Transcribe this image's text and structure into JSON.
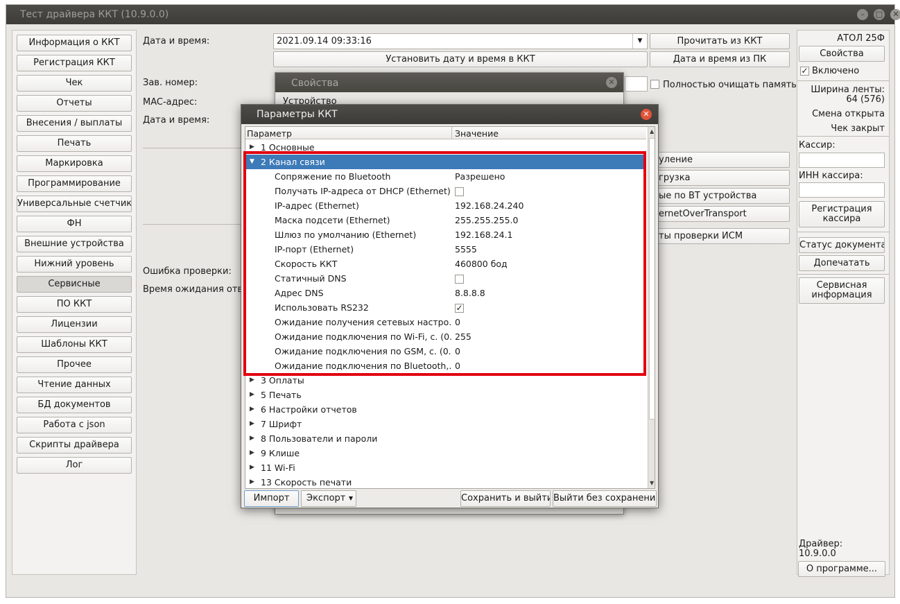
{
  "window": {
    "title": "Тест драйвера ККТ (10.9.0.0)"
  },
  "nav": [
    "Информация о ККТ",
    "Регистрация ККТ",
    "Чек",
    "Отчеты",
    "Внесения / выплаты",
    "Печать",
    "Маркировка",
    "Программирование",
    "Универсальные счетчики",
    "ФН",
    "Внешние устройства",
    "Нижний уровень",
    "Сервисные",
    "ПО ККТ",
    "Лицензии",
    "Шаблоны ККТ",
    "Прочее",
    "Чтение данных",
    "БД документов",
    "Работа с json",
    "Скрипты драйвера",
    "Лог"
  ],
  "nav_selected": "Сервисные",
  "main": {
    "date_label": "Дата и время:",
    "date_value": "2021.09.14 09:33:16",
    "read_btn": "Прочитать из ККТ",
    "set_btn": "Установить дату и время в ККТ",
    "pc_btn": "Дата и время из ПК",
    "serial_label": "Зав. номер:",
    "mac_label": "MAC-адрес:",
    "date_label2": "Дата и время:",
    "clear_label": "Полностью очищать память",
    "btn_a": "уление",
    "btn_b": "грузка",
    "btn_c": "ые по BT устройства",
    "btn_d": "ernetOverTransport",
    "btn_e": "ты проверки ИСМ",
    "err_label": "Ошибка проверки:",
    "wait_label": "Время ожидания ответ"
  },
  "right": {
    "model": "АТОЛ 25Ф",
    "props_btn": "Свойства",
    "enabled_label": "Включено",
    "tape_label": "Ширина ленты:",
    "tape_value": "64 (576)",
    "shift": "Смена открыта",
    "receipt": "Чек закрыт",
    "cashier_label": "Кассир:",
    "inn_label": "ИНН кассира:",
    "reg_btn_1": "Регистрация",
    "reg_btn_2": "кассира",
    "status_btn": "Статус документа",
    "reprint_btn": "Допечатать",
    "service_btn_1": "Сервисная",
    "service_btn_2": "информация",
    "driver_label": "Драйвер:",
    "driver_version": "10.9.0.0",
    "about_btn": "О программе..."
  },
  "props_dialog": {
    "title": "Свойства",
    "tab": "Устройство"
  },
  "params_dialog": {
    "title": "Параметры ККТ",
    "col_param": "Параметр",
    "col_value": "Значение",
    "rows": [
      {
        "label": "1 Основные",
        "group": true,
        "expanded": false
      },
      {
        "label": "2 Канал связи",
        "group": true,
        "expanded": true,
        "selected": true
      },
      {
        "label": "Сопряжение по Bluetooth",
        "value": "Разрешено"
      },
      {
        "label": "Получать IP-адреса от DHCP (Ethernet)",
        "check": false
      },
      {
        "label": "IP-адрес (Ethernet)",
        "value": "192.168.24.240"
      },
      {
        "label": "Маска подсети (Ethernet)",
        "value": "255.255.255.0"
      },
      {
        "label": "Шлюз по умолчанию (Ethernet)",
        "value": "192.168.24.1"
      },
      {
        "label": "IP-порт (Ethernet)",
        "value": "5555"
      },
      {
        "label": "Скорость ККТ",
        "value": "460800 бод"
      },
      {
        "label": "Статичный DNS",
        "check": false
      },
      {
        "label": "Адрес DNS",
        "value": "8.8.8.8"
      },
      {
        "label": "Использовать RS232",
        "check": true
      },
      {
        "label": "Ожидание получения сетевых настро...",
        "value": "0"
      },
      {
        "label": "Ожидание подключения по Wi-Fi, с. (0...",
        "value": "255"
      },
      {
        "label": "Ожидание подключения по GSM, с. (0...",
        "value": "0"
      },
      {
        "label": "Ожидание подключения по Bluetooth,...",
        "value": "0"
      },
      {
        "label": "3 Оплаты",
        "group": true,
        "expanded": false
      },
      {
        "label": "5 Печать",
        "group": true,
        "expanded": false
      },
      {
        "label": "6 Настройки отчетов",
        "group": true,
        "expanded": false
      },
      {
        "label": "7 Шрифт",
        "group": true,
        "expanded": false
      },
      {
        "label": "8 Пользователи и пароли",
        "group": true,
        "expanded": false
      },
      {
        "label": "9 Клише",
        "group": true,
        "expanded": false
      },
      {
        "label": "11 Wi-Fi",
        "group": true,
        "expanded": false
      },
      {
        "label": "13 Скорость печати",
        "group": true,
        "expanded": false
      }
    ],
    "import_btn": "Импорт",
    "export_btn": "Экспорт",
    "save_btn": "Сохранить и выйти",
    "exit_btn": "Выйти без сохранения"
  },
  "colors": {
    "highlight": "#e2000f",
    "selection": "#3d7ab8"
  }
}
